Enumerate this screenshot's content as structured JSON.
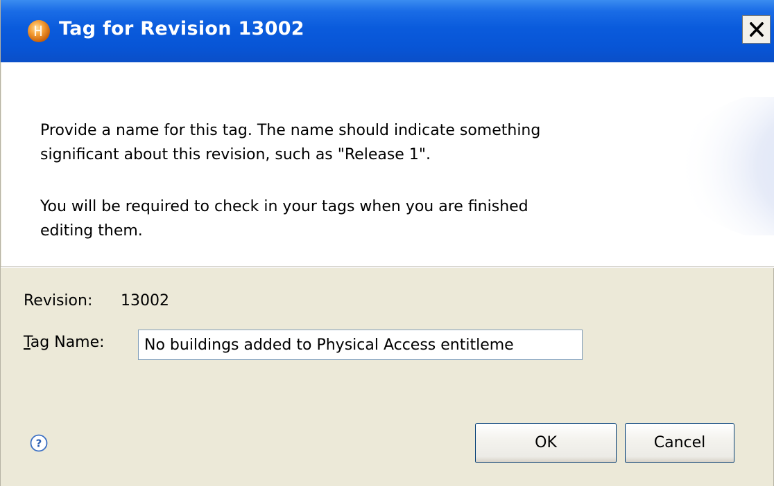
{
  "window": {
    "title": "Tag for Revision 13002",
    "icon": "orange-sphere-icon",
    "close_label": "close-icon"
  },
  "message": {
    "line1a": "Provide a name for this tag.  The name should indicate something",
    "line1b": "significant about this revision, such as \"Release 1\".",
    "line2a": "You will be required to check in your tags when you are finished",
    "line2b": "editing them."
  },
  "form": {
    "revision_label": "Revision:",
    "revision_value": "13002",
    "tag_label_mnemonic": "T",
    "tag_label_rest": "ag Name:",
    "tag_value": "No buildings added to Physical Access entitleme"
  },
  "footer": {
    "help_icon": "help-icon",
    "ok_label": "OK",
    "cancel_label": "Cancel"
  },
  "colors": {
    "titlebar": "#0a5bdc",
    "dialog_bg": "#ece9d8",
    "message_bg": "#ffffff"
  }
}
